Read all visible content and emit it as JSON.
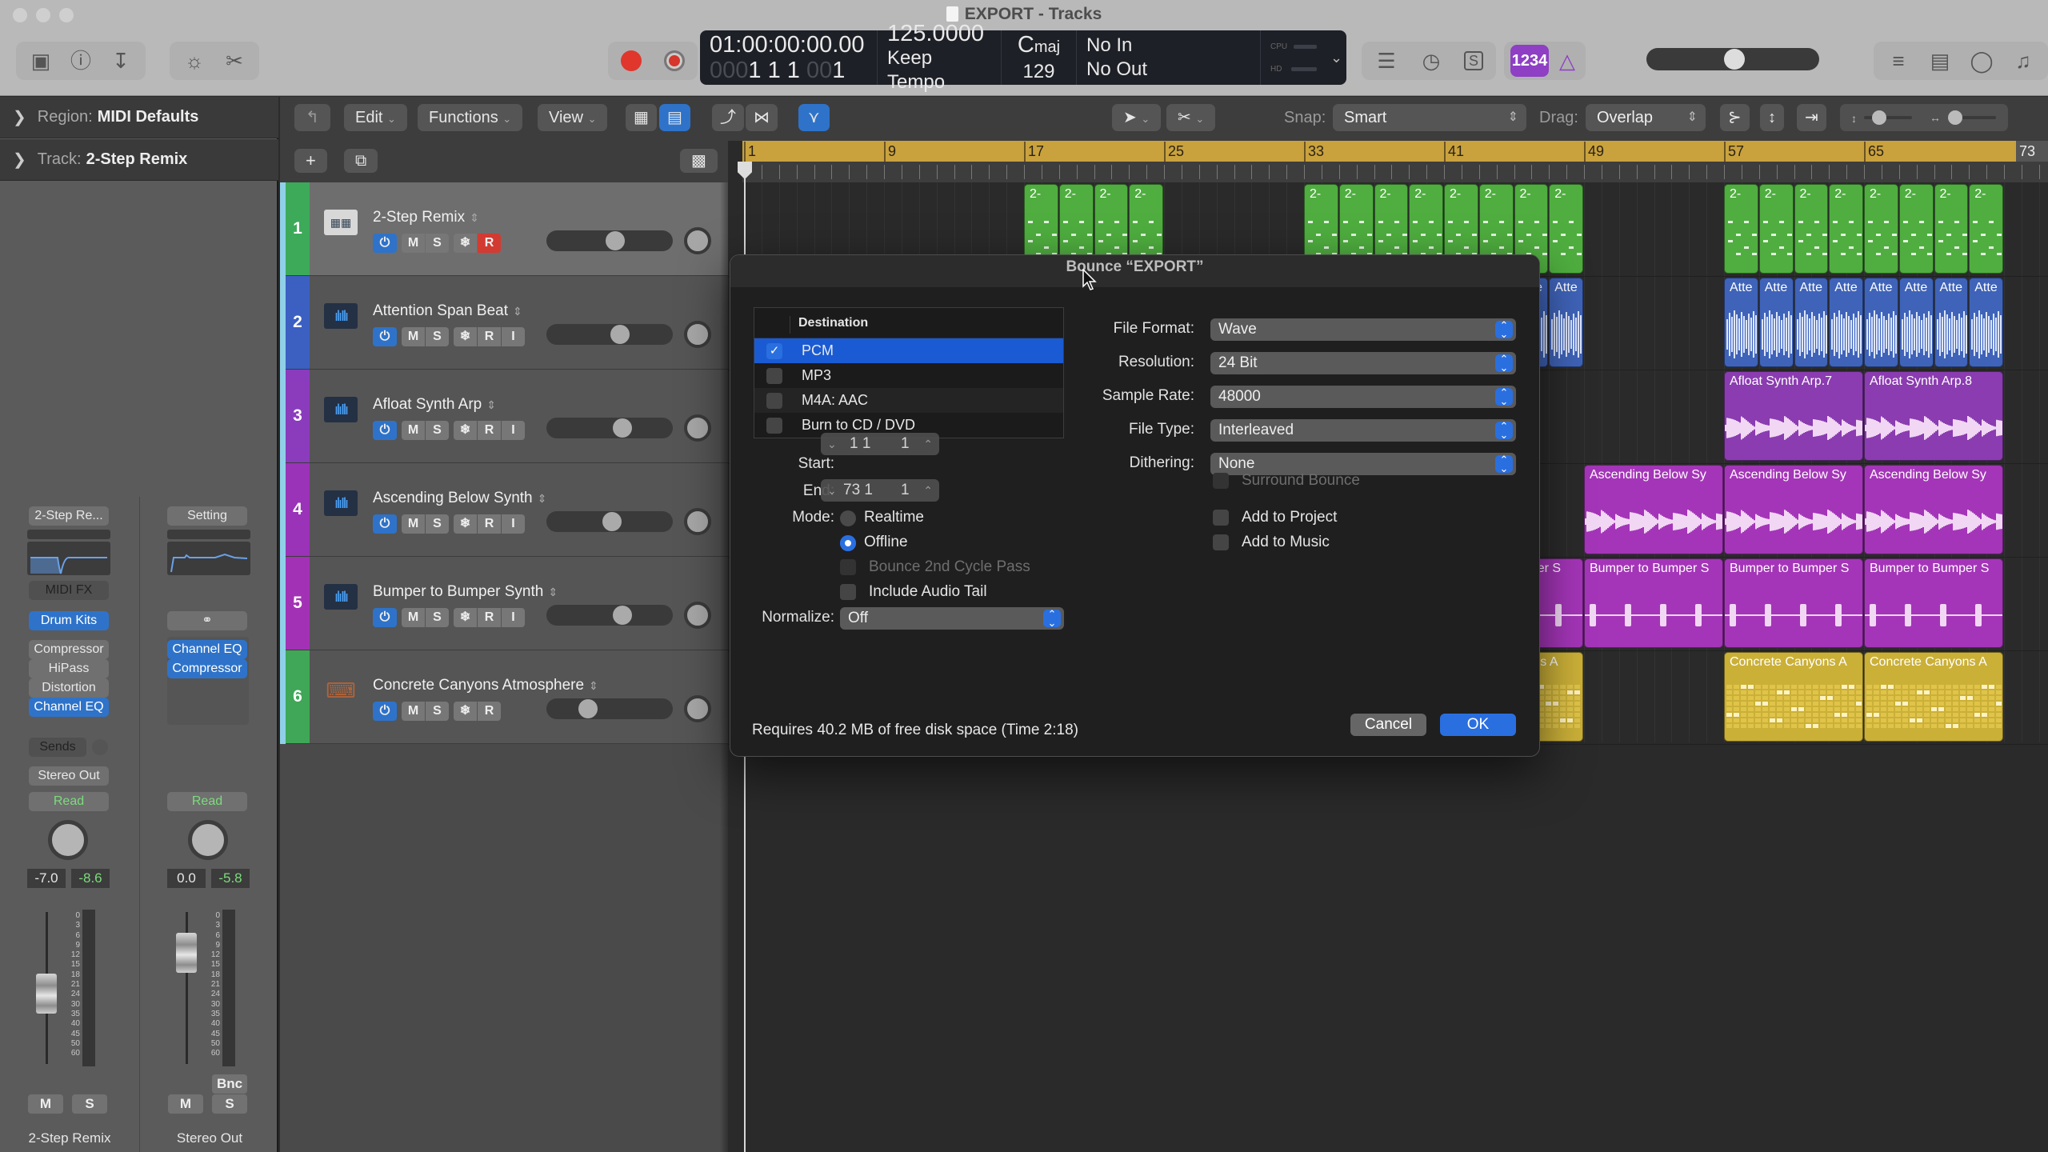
{
  "window": {
    "title": "EXPORT - Tracks"
  },
  "toolbar": {
    "left_icons": [
      "library-icon",
      "quick-help-icon",
      "toolbar-download-icon"
    ],
    "mid_icons": [
      "smart-controls-icon",
      "scissors-icon"
    ],
    "record_buttons": [
      "record-button",
      "capture-record-button"
    ],
    "right_icons": [
      "mixer-icon",
      "tuner-icon",
      "solo-icon"
    ],
    "count_in_label": "1234",
    "metronome_icon": "metronome-icon",
    "master_volume": 0.5,
    "far_right_icons": [
      "list-editors-icon",
      "note-pad-icon",
      "loop-browser-icon",
      "media-browser-icon"
    ]
  },
  "lcd": {
    "timecode": "01:00:00:00.00",
    "position_dim": "000",
    "position_bars": "1  1  1",
    "position_dim2": "00",
    "position_tick": "1",
    "tempo": "125.0000",
    "tempo_mode": "Keep Tempo",
    "key_main": "C",
    "key_mode": "maj",
    "time_sig": "129",
    "input": "No In",
    "output": "No Out",
    "cpu_label": "CPU",
    "hd_label": "HD"
  },
  "inspector": {
    "region_label": "Region:",
    "region_value": "MIDI Defaults",
    "track_label": "Track:",
    "track_value": "2-Step Remix",
    "strips": [
      {
        "setting": "2-Step Re...",
        "midi_fx": "MIDI FX",
        "instrument": "Drum Kits",
        "plugins": [
          {
            "name": "Compressor",
            "active": false
          },
          {
            "name": "HiPass",
            "active": false
          },
          {
            "name": "Distortion",
            "active": false
          },
          {
            "name": "Channel EQ",
            "active": true
          }
        ],
        "sends": "Sends",
        "output": "Stereo Out",
        "automation": "Read",
        "volume": "-7.0",
        "peak": "-8.6",
        "mute": "M",
        "solo": "S",
        "name": "2-Step Remix"
      },
      {
        "setting": "Setting",
        "link_icon": "link-icon",
        "plugins": [
          {
            "name": "Channel EQ",
            "active": true
          },
          {
            "name": "Compressor",
            "active": true
          }
        ],
        "automation": "Read",
        "volume": "0.0",
        "peak": "-5.8",
        "bounce": "Bnc",
        "mute": "M",
        "solo": "S",
        "name": "Stereo Out"
      }
    ],
    "meter_scale": [
      "0",
      "3",
      "6",
      "9",
      "12",
      "15",
      "18",
      "21",
      "24",
      "30",
      "35",
      "40",
      "45",
      "50",
      "60"
    ]
  },
  "tracks_toolbar": {
    "back_icon": "catch-up-icon",
    "menus": [
      "Edit",
      "Functions",
      "View"
    ],
    "snap_label": "Snap:",
    "snap_value": "Smart",
    "drag_label": "Drag:",
    "drag_value": "Overlap"
  },
  "ruler": {
    "bars": [
      "1",
      "9",
      "17",
      "25",
      "33",
      "41",
      "49",
      "57",
      "65"
    ],
    "end_bar": "73"
  },
  "tracks": [
    {
      "number": "1",
      "name": "2-Step Remix",
      "color": "#3daa5a",
      "icon": "drum-machine-icon",
      "record_armed": true,
      "has_input": false,
      "volume": 0.55
    },
    {
      "number": "2",
      "name": "Attention Span Beat",
      "color": "#3c5fc2",
      "icon": "waveform-icon",
      "record_armed": false,
      "has_input": true,
      "volume": 0.6
    },
    {
      "number": "3",
      "name": "Afloat Synth Arp",
      "color": "#8a3cbd",
      "icon": "waveform-icon",
      "record_armed": false,
      "has_input": true,
      "volume": 0.62
    },
    {
      "number": "4",
      "name": "Ascending Below Synth",
      "color": "#9a33b8",
      "icon": "waveform-icon",
      "record_armed": false,
      "has_input": true,
      "volume": 0.52
    },
    {
      "number": "5",
      "name": "Bumper to Bumper Synth",
      "color": "#a331b5",
      "icon": "waveform-icon",
      "record_armed": false,
      "has_input": true,
      "volume": 0.62
    },
    {
      "number": "6",
      "name": "Concrete Canyons Atmosphere",
      "color": "#3fa757",
      "icon": "keyboard-stand-icon",
      "record_armed": false,
      "has_input": false,
      "volume": 0.3
    }
  ],
  "regions": {
    "green_label": "2-",
    "blue_label": "Atte",
    "afloat": [
      "Afloat Synth Arp.7",
      "Afloat Synth Arp.8"
    ],
    "ascending": "Ascending Below Sy",
    "bumper": "Bumper to Bumper S",
    "bumper_partial": "mper S",
    "concrete": "Concrete Canyons A",
    "concrete_partial": "yons A",
    "blue_partial": "e"
  },
  "bounce_dialog": {
    "title": "Bounce “EXPORT”",
    "destination_header": "Destination",
    "destinations": [
      {
        "label": "PCM",
        "checked": true,
        "selected": true
      },
      {
        "label": "MP3",
        "checked": false,
        "selected": false
      },
      {
        "label": "M4A: AAC",
        "checked": false,
        "selected": false
      },
      {
        "label": "Burn to CD / DVD",
        "checked": false,
        "selected": false
      }
    ],
    "start_label": "Start:",
    "start_value": "1 1",
    "start_value2": "1",
    "end_label": "End:",
    "end_value": "73 1",
    "end_value2": "1",
    "mode_label": "Mode:",
    "modes": [
      {
        "label": "Realtime",
        "selected": false
      },
      {
        "label": "Offline",
        "selected": true
      }
    ],
    "bounce_2nd_cycle": "Bounce 2nd Cycle Pass",
    "include_audio_tail": "Include Audio Tail",
    "normalize_label": "Normalize:",
    "normalize_value": "Off",
    "fields": [
      {
        "label": "File Format:",
        "value": "Wave"
      },
      {
        "label": "Resolution:",
        "value": "24 Bit"
      },
      {
        "label": "Sample Rate:",
        "value": "48000"
      },
      {
        "label": "File Type:",
        "value": "Interleaved"
      },
      {
        "label": "Dithering:",
        "value": "None"
      }
    ],
    "surround_bounce": "Surround Bounce",
    "add_to_project": "Add to Project",
    "add_to_music": "Add to Music",
    "disk_info": "Requires 40.2 MB of free disk space  (Time 2:18)",
    "cancel": "Cancel",
    "ok": "OK"
  },
  "colors": {
    "accent_blue": "#2a6fe0",
    "record_red": "#e0362c",
    "ruler_yellow": "#c9a23e",
    "count_in_purple": "#8e3fc4"
  }
}
